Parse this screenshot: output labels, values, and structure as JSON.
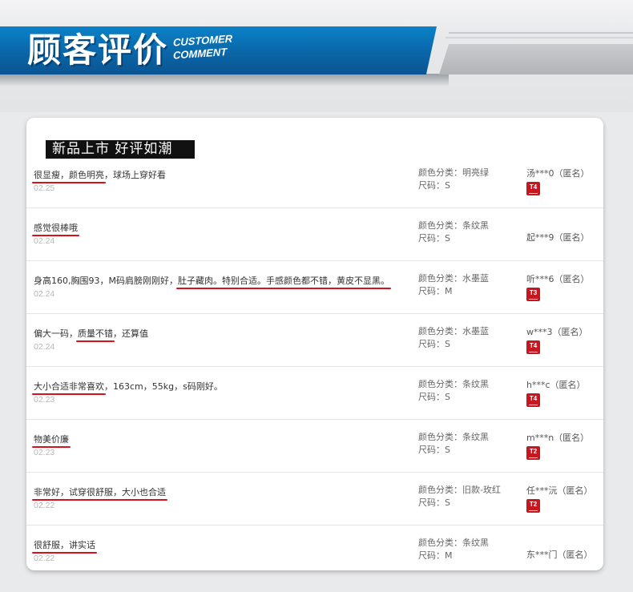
{
  "header": {
    "title_cn": "顾客评价",
    "title_en_line1": "CUSTOMER",
    "title_en_line2": "COMMENT",
    "brand_color": "#0a6cb0"
  },
  "card": {
    "heading": "新品上市 好评如潮"
  },
  "reviews": [
    {
      "segments": [
        {
          "text": "很显瘦，颜色明亮",
          "highlight": true
        },
        {
          "text": "，球场上穿好看",
          "highlight": false
        }
      ],
      "date": "02.25",
      "color": "颜色分类：明亮绿",
      "size": "尺码：S",
      "user": "汤***0（匿名）",
      "badge": "T4"
    },
    {
      "segments": [
        {
          "text": "感觉很棒哦",
          "highlight": true
        }
      ],
      "date": "02.24",
      "color": "颜色分类：条纹黑",
      "size": "尺码：S",
      "user": "起***9（匿名）",
      "badge": ""
    },
    {
      "segments": [
        {
          "text": "身高160,胸围93，M码肩膀刚刚好，",
          "highlight": false
        },
        {
          "text": "肚子藏肉。特别合适。手感颜色都不错，黄皮不显黑。",
          "highlight": true
        }
      ],
      "date": "02.24",
      "color": "颜色分类：水墨蓝",
      "size": "尺码：M",
      "user": "听***6（匿名）",
      "badge": "T3"
    },
    {
      "segments": [
        {
          "text": "偏大一码，",
          "highlight": false
        },
        {
          "text": "质量不错",
          "highlight": true
        },
        {
          "text": "，还算值",
          "highlight": false
        }
      ],
      "date": "02.24",
      "color": "颜色分类：水墨蓝",
      "size": "尺码：S",
      "user": "w***3（匿名）",
      "badge": "T4"
    },
    {
      "segments": [
        {
          "text": "大小合适非常喜欢",
          "highlight": true
        },
        {
          "text": "，163cm，55kg，s码刚好。",
          "highlight": false
        }
      ],
      "date": "02.23",
      "color": "颜色分类：条纹黑",
      "size": "尺码：S",
      "user": "h***c（匿名）",
      "badge": "T4"
    },
    {
      "segments": [
        {
          "text": "物美价廉",
          "highlight": true
        }
      ],
      "date": "02.23",
      "color": "颜色分类：条纹黑",
      "size": "尺码：S",
      "user": "m***n（匿名）",
      "badge": "T2"
    },
    {
      "segments": [
        {
          "text": "非常好，试穿很舒服，大小也合适",
          "highlight": true
        }
      ],
      "date": "02.22",
      "color": "颜色分类：旧款-玫红",
      "size": "尺码：S",
      "user": "任***沅（匿名）",
      "badge": "T2"
    },
    {
      "segments": [
        {
          "text": "很舒服，讲实话",
          "highlight": true
        }
      ],
      "date": "02.22",
      "color": "颜色分类：条纹黑",
      "size": "尺码：M",
      "user": "东***门（匿名）",
      "badge": ""
    }
  ]
}
